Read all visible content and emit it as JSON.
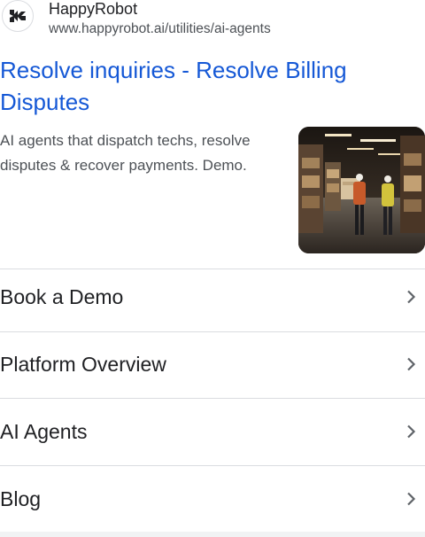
{
  "site": {
    "name": "HappyRobot",
    "url": "www.happyrobot.ai/utilities/ai-agents",
    "favicon_icon": "happyrobot-logo-icon"
  },
  "result": {
    "title": "Resolve inquiries - Resolve Billing Disputes",
    "snippet": "AI agents that dispatch techs, resolve disputes & recover payments. Demo.",
    "thumbnail_icon": "warehouse-workers-photo"
  },
  "sitelinks": [
    {
      "label": "Book a Demo",
      "icon": "chevron-right-icon"
    },
    {
      "label": "Platform Overview",
      "icon": "chevron-right-icon"
    },
    {
      "label": "AI Agents",
      "icon": "chevron-right-icon"
    },
    {
      "label": "Blog",
      "icon": "chevron-right-icon"
    }
  ],
  "colors": {
    "title_link": "#1558d6",
    "text": "#202124",
    "secondary_text": "#4d5156",
    "divider": "#dadce0"
  }
}
